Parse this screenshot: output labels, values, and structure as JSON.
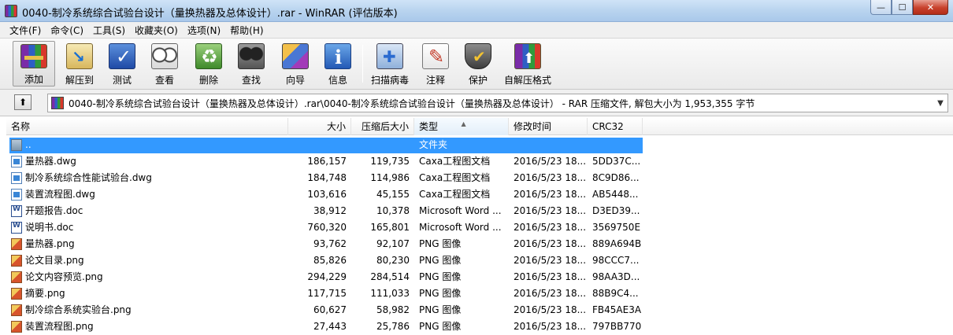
{
  "window": {
    "title": "0040-制冷系统综合试验台设计（量换热器及总体设计）.rar - WinRAR (评估版本)",
    "buttons": {
      "minimize": "—",
      "maximize": "☐",
      "close": "✕"
    }
  },
  "menu": [
    "文件(F)",
    "命令(C)",
    "工具(S)",
    "收藏夹(O)",
    "选项(N)",
    "帮助(H)"
  ],
  "toolbar": [
    {
      "label": "添加",
      "icon": "add-archive-icon"
    },
    {
      "label": "解压到",
      "icon": "extract-to-icon"
    },
    {
      "label": "测试",
      "icon": "test-icon"
    },
    {
      "label": "查看",
      "icon": "view-icon"
    },
    {
      "label": "删除",
      "icon": "delete-icon"
    },
    {
      "label": "查找",
      "icon": "find-icon"
    },
    {
      "label": "向导",
      "icon": "wizard-icon"
    },
    {
      "label": "信息",
      "icon": "info-icon"
    },
    {
      "label": "扫描病毒",
      "icon": "virus-scan-icon"
    },
    {
      "label": "注释",
      "icon": "comment-icon"
    },
    {
      "label": "保护",
      "icon": "protect-icon"
    },
    {
      "label": "自解压格式",
      "icon": "sfx-icon"
    }
  ],
  "address": {
    "up_label": "⬆",
    "path": "0040-制冷系统综合试验台设计（量换热器及总体设计）.rar\\0040-制冷系统综合试验台设计（量换热器及总体设计） - RAR 压缩文件, 解包大小为 1,953,355 字节"
  },
  "columns": {
    "name": "名称",
    "size": "大小",
    "packed": "压缩后大小",
    "type": "类型",
    "modified": "修改时间",
    "crc": "CRC32"
  },
  "files": [
    {
      "name": "..",
      "size": "",
      "packed": "",
      "type": "文件夹",
      "modified": "",
      "crc": "",
      "kind": "folder"
    },
    {
      "name": "量热器.dwg",
      "size": "186,157",
      "packed": "119,735",
      "type": "Caxa工程图文档",
      "modified": "2016/5/23 18...",
      "crc": "5DD37C...",
      "kind": "dwg"
    },
    {
      "name": "制冷系统综合性能试验台.dwg",
      "size": "184,748",
      "packed": "114,986",
      "type": "Caxa工程图文档",
      "modified": "2016/5/23 18...",
      "crc": "8C9D86...",
      "kind": "dwg"
    },
    {
      "name": "装置流程图.dwg",
      "size": "103,616",
      "packed": "45,155",
      "type": "Caxa工程图文档",
      "modified": "2016/5/23 18...",
      "crc": "AB5448...",
      "kind": "dwg"
    },
    {
      "name": "开题报告.doc",
      "size": "38,912",
      "packed": "10,378",
      "type": "Microsoft Word ...",
      "modified": "2016/5/23 18...",
      "crc": "D3ED39...",
      "kind": "doc"
    },
    {
      "name": "说明书.doc",
      "size": "760,320",
      "packed": "165,801",
      "type": "Microsoft Word ...",
      "modified": "2016/5/23 18...",
      "crc": "3569750E",
      "kind": "doc"
    },
    {
      "name": "量热器.png",
      "size": "93,762",
      "packed": "92,107",
      "type": "PNG 图像",
      "modified": "2016/5/23 18...",
      "crc": "889A694B",
      "kind": "png"
    },
    {
      "name": "论文目录.png",
      "size": "85,826",
      "packed": "80,230",
      "type": "PNG 图像",
      "modified": "2016/5/23 18...",
      "crc": "98CCC7...",
      "kind": "png"
    },
    {
      "name": "论文内容预览.png",
      "size": "294,229",
      "packed": "284,514",
      "type": "PNG 图像",
      "modified": "2016/5/23 18...",
      "crc": "98AA3D...",
      "kind": "png"
    },
    {
      "name": "摘要.png",
      "size": "117,715",
      "packed": "111,033",
      "type": "PNG 图像",
      "modified": "2016/5/23 18...",
      "crc": "88B9C4...",
      "kind": "png"
    },
    {
      "name": "制冷综合系统实验台.png",
      "size": "60,627",
      "packed": "58,982",
      "type": "PNG 图像",
      "modified": "2016/5/23 18...",
      "crc": "FB45AE3A",
      "kind": "png"
    },
    {
      "name": "装置流程图.png",
      "size": "27,443",
      "packed": "25,786",
      "type": "PNG 图像",
      "modified": "2016/5/23 18...",
      "crc": "797BB770",
      "kind": "png"
    }
  ]
}
